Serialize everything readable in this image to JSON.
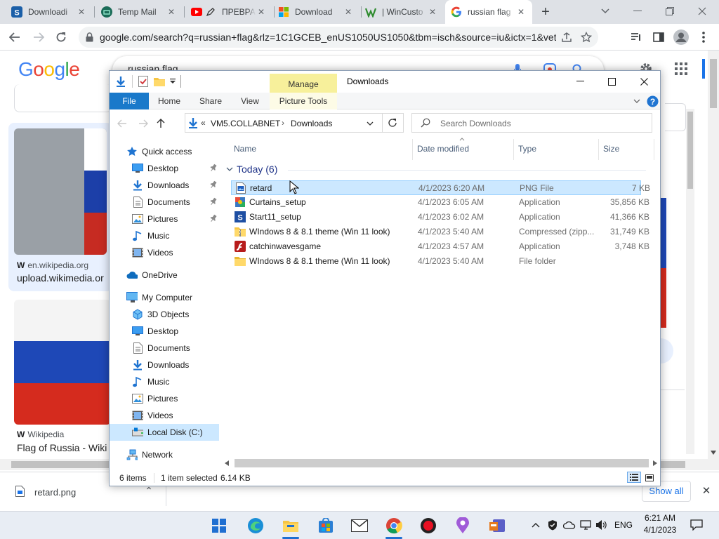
{
  "chrome": {
    "tabs": [
      {
        "title": "Downloadi",
        "icon": "s-logo-icon",
        "close": "✕"
      },
      {
        "title": "Temp Mail",
        "icon": "temp-mail-icon",
        "close": "✕"
      },
      {
        "title": "ПРЕВРА",
        "icon": "youtube-icon",
        "close": "✕"
      },
      {
        "title": "Download",
        "icon": "windows-logo-icon",
        "close": "✕"
      },
      {
        "title": "| WinCusto",
        "icon": "wincustomize-icon",
        "close": "✕"
      },
      {
        "title": "russian flag",
        "icon": "google-icon",
        "close": "✕"
      }
    ],
    "new_tab": "+",
    "url": "google.com/search?q=russian+flag&rlz=1C1GCEB_enUS1050US1050&tbm=isch&source=iu&ictx=1&vet=..."
  },
  "google": {
    "logo": [
      "G",
      "o",
      "o",
      "g",
      "l",
      "e"
    ],
    "logo_colors": [
      "#4285f4",
      "#ea4335",
      "#fbbc05",
      "#4285f4",
      "#34a853",
      "#ea4335"
    ],
    "query": "russian flag",
    "results": [
      {
        "source": "en.wikipedia.org",
        "title": "upload.wikimedia.or"
      },
      {
        "source": "Wikipedia",
        "title": "Flag of Russia - Wiki"
      }
    ],
    "show_all": "Show all"
  },
  "download_bar": {
    "file": "retard.png",
    "expand": "⌃",
    "show_all": "Show all",
    "close": "✕"
  },
  "explorer": {
    "manage": "Manage",
    "title": "Downloads",
    "ribbon": {
      "file": "File",
      "home": "Home",
      "share": "Share",
      "view": "View",
      "picture_tools": "Picture Tools"
    },
    "address": {
      "prefix": "«",
      "host": "VM5.COLLABNET",
      "sep": "›",
      "folder": "Downloads"
    },
    "search_placeholder": "Search Downloads",
    "nav": [
      {
        "label": "Quick access",
        "icon": "star-icon",
        "indent": 0,
        "pinned": false
      },
      {
        "label": "Desktop",
        "icon": "desktop-icon",
        "indent": 1,
        "pinned": true
      },
      {
        "label": "Downloads",
        "icon": "downloads-icon",
        "indent": 1,
        "pinned": true
      },
      {
        "label": "Documents",
        "icon": "documents-icon",
        "indent": 1,
        "pinned": true
      },
      {
        "label": "Pictures",
        "icon": "pictures-icon",
        "indent": 1,
        "pinned": true
      },
      {
        "label": "Music",
        "icon": "music-icon",
        "indent": 1,
        "pinned": false
      },
      {
        "label": "Videos",
        "icon": "videos-icon",
        "indent": 1,
        "pinned": false
      },
      {
        "label": "OneDrive",
        "icon": "onedrive-icon",
        "indent": 0,
        "pinned": false
      },
      {
        "label": "My Computer",
        "icon": "computer-icon",
        "indent": 0,
        "pinned": false
      },
      {
        "label": "3D Objects",
        "icon": "3d-objects-icon",
        "indent": 1,
        "pinned": false
      },
      {
        "label": "Desktop",
        "icon": "desktop-icon",
        "indent": 1,
        "pinned": false
      },
      {
        "label": "Documents",
        "icon": "documents-icon",
        "indent": 1,
        "pinned": false
      },
      {
        "label": "Downloads",
        "icon": "downloads-icon",
        "indent": 1,
        "pinned": false
      },
      {
        "label": "Music",
        "icon": "music-icon",
        "indent": 1,
        "pinned": false
      },
      {
        "label": "Pictures",
        "icon": "pictures-icon",
        "indent": 1,
        "pinned": false
      },
      {
        "label": "Videos",
        "icon": "videos-icon",
        "indent": 1,
        "pinned": false
      },
      {
        "label": "Local Disk (C:)",
        "icon": "drive-icon",
        "indent": 1,
        "pinned": false,
        "selected": true
      },
      {
        "label": "Network",
        "icon": "network-icon",
        "indent": 0,
        "pinned": false
      }
    ],
    "columns": {
      "name": "Name",
      "date": "Date modified",
      "type": "Type",
      "size": "Size"
    },
    "group": {
      "label": "Today (6)"
    },
    "files": [
      {
        "name": "retard",
        "date": "4/1/2023 6:20 AM",
        "type": "PNG File",
        "size": "7 KB",
        "icon": "image-file-icon",
        "selected": true
      },
      {
        "name": "Curtains_setup",
        "date": "4/1/2023 6:05 AM",
        "type": "Application",
        "size": "35,856 KB",
        "icon": "installer-icon",
        "selected": false
      },
      {
        "name": "Start11_setup",
        "date": "4/1/2023 6:02 AM",
        "type": "Application",
        "size": "41,366 KB",
        "icon": "start11-icon",
        "selected": false
      },
      {
        "name": "WIndows 8 & 8.1 theme (Win 11 look)",
        "date": "4/1/2023 5:40 AM",
        "type": "Compressed (zipp...",
        "size": "31,749 KB",
        "icon": "zip-folder-icon",
        "selected": false
      },
      {
        "name": "catchinwavesgame",
        "date": "4/1/2023 4:57 AM",
        "type": "Application",
        "size": "3,748 KB",
        "icon": "flash-app-icon",
        "selected": false
      },
      {
        "name": "WIndows 8 & 8.1 theme (Win 11 look)",
        "date": "4/1/2023 5:40 AM",
        "type": "File folder",
        "size": "",
        "icon": "folder-icon",
        "selected": false
      }
    ],
    "status": {
      "count": "6 items",
      "selected": "1 item selected",
      "size": "6.14 KB"
    }
  },
  "taskbar": {
    "language": "ENG",
    "time": "6:21 AM",
    "date": "4/1/2023"
  }
}
